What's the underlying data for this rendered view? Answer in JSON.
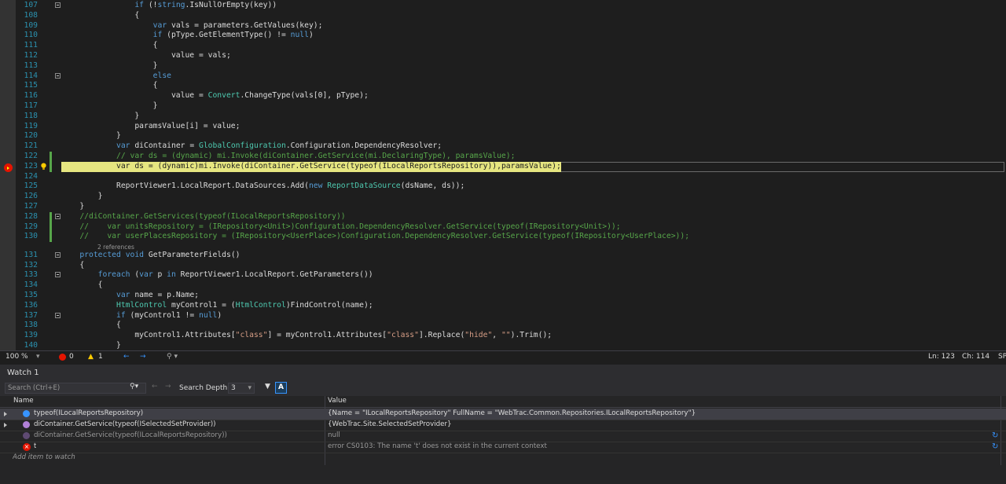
{
  "editor": {
    "lines": [
      {
        "n": "107",
        "indent": "                ",
        "html": "<span class='kw'>if</span> (!<span class='kw'>string</span>.IsNullOrEmpty(key))"
      },
      {
        "n": "108",
        "indent": "                ",
        "html": "{"
      },
      {
        "n": "109",
        "indent": "                    ",
        "html": "<span class='kw'>var</span> vals = parameters.GetValues(key);"
      },
      {
        "n": "110",
        "indent": "                    ",
        "html": "<span class='kw'>if</span> (pType.GetElementType() != <span class='kw'>null</span>)"
      },
      {
        "n": "111",
        "indent": "                    ",
        "html": "{"
      },
      {
        "n": "112",
        "indent": "                        ",
        "html": "value = vals;"
      },
      {
        "n": "113",
        "indent": "                    ",
        "html": "}"
      },
      {
        "n": "114",
        "indent": "                    ",
        "html": "<span class='kw'>else</span>"
      },
      {
        "n": "115",
        "indent": "                    ",
        "html": "{"
      },
      {
        "n": "116",
        "indent": "                        ",
        "html": "value = <span class='ty'>Convert</span>.ChangeType(vals[0], pType);"
      },
      {
        "n": "117",
        "indent": "                    ",
        "html": "}"
      },
      {
        "n": "118",
        "indent": "                ",
        "html": "}"
      },
      {
        "n": "119",
        "indent": "                ",
        "html": "paramsValue[i] = value;"
      },
      {
        "n": "120",
        "indent": "            ",
        "html": "}"
      },
      {
        "n": "121",
        "indent": "            ",
        "html": "<span class='kw'>var</span> diContainer = <span class='ty'>GlobalConfiguration</span>.Configuration.DependencyResolver;"
      },
      {
        "n": "122",
        "indent": "            ",
        "html": "<span class='cm'>// var ds = (dynamic) mi.Invoke(diContainer.GetService(mi.DeclaringType), paramsValue);</span>"
      },
      {
        "n": "123",
        "indent": "            ",
        "html": "<span class='kw'>var</span> ds = (<span class='kw'>dynamic</span>)mi.Invoke(diContainer.GetService(<span class='kw'>typeof</span>(<span class='ty'>ILocalReportsRepository</span>)),paramsValue);"
      },
      {
        "n": "124",
        "indent": "",
        "html": ""
      },
      {
        "n": "125",
        "indent": "            ",
        "html": "ReportViewer1.LocalReport.DataSources.Add(<span class='kw'>new</span> <span class='ty'>ReportDataSource</span>(dsName, ds));"
      },
      {
        "n": "126",
        "indent": "        ",
        "html": "}"
      },
      {
        "n": "127",
        "indent": "    ",
        "html": "}"
      },
      {
        "n": "128",
        "indent": "    ",
        "html": "<span class='cm'>//diContainer.GetServices(typeof(ILocalReportsRepository))</span>"
      },
      {
        "n": "129",
        "indent": "    ",
        "html": "<span class='cm'>//    var unitsRepository = (IRepository&lt;Unit&gt;)Configuration.DependencyResolver.GetService(typeof(IRepository&lt;Unit&gt;));</span>"
      },
      {
        "n": "130",
        "indent": "    ",
        "html": "<span class='cm'>//    var userPlacesRepository = (IRepository&lt;UserPlace&gt;)Configuration.DependencyResolver.GetService(typeof(IRepository&lt;UserPlace&gt;));</span>"
      },
      {
        "n": "131",
        "indent": "    ",
        "html": "<span class='kw'>protected</span> <span class='kw'>void</span> GetParameterFields()"
      },
      {
        "n": "132",
        "indent": "    ",
        "html": "{"
      },
      {
        "n": "133",
        "indent": "        ",
        "html": "<span class='kw'>foreach</span> (<span class='kw'>var</span> p <span class='kw'>in</span> ReportViewer1.LocalReport.GetParameters())"
      },
      {
        "n": "134",
        "indent": "        ",
        "html": "{"
      },
      {
        "n": "135",
        "indent": "            ",
        "html": "<span class='kw'>var</span> name = p.Name;"
      },
      {
        "n": "136",
        "indent": "            ",
        "html": "<span class='ty'>HtmlControl</span> myControl1 = (<span class='ty'>HtmlControl</span>)FindControl(name);"
      },
      {
        "n": "137",
        "indent": "            ",
        "html": "<span class='kw'>if</span> (myControl1 != <span class='kw'>null</span>)"
      },
      {
        "n": "138",
        "indent": "            ",
        "html": "{"
      },
      {
        "n": "139",
        "indent": "                ",
        "html": "myControl1.Attributes[<span class='st'>\"class\"</span>] = myControl1.Attributes[<span class='st'>\"class\"</span>].Replace(<span class='st'>\"hide\"</span>, <span class='st'>\"\"</span>).Trim();"
      },
      {
        "n": "140",
        "indent": "            ",
        "html": "}"
      }
    ],
    "references_label": "2 references"
  },
  "status": {
    "zoom": "100 %",
    "errors": "0",
    "warnings": "1",
    "line": "Ln: 123",
    "col": "Ch: 114",
    "mode": "SP"
  },
  "watch": {
    "title": "Watch 1",
    "search_placeholder": "Search (Ctrl+E)",
    "depth_label": "Search Depth:",
    "depth_value": "3",
    "col_name": "Name",
    "col_value": "Value",
    "rows": [
      {
        "name": "typeof(ILocalReportsRepository)",
        "value": "{Name = \"ILocalReportsRepository\" FullName = \"WebTrac.Common.Repositories.ILocalReportsRepository\"}"
      },
      {
        "name": "diContainer.GetService(typeof(ISelectedSetProvider))",
        "value": "{WebTrac.Site.SelectedSetProvider}"
      },
      {
        "name": "diContainer.GetService(typeof(ILocalReportsRepository))",
        "value": "null"
      },
      {
        "name": "t",
        "value": "error CS0103: The name 't' does not exist in the current context"
      }
    ],
    "add_item": "Add item to watch"
  }
}
